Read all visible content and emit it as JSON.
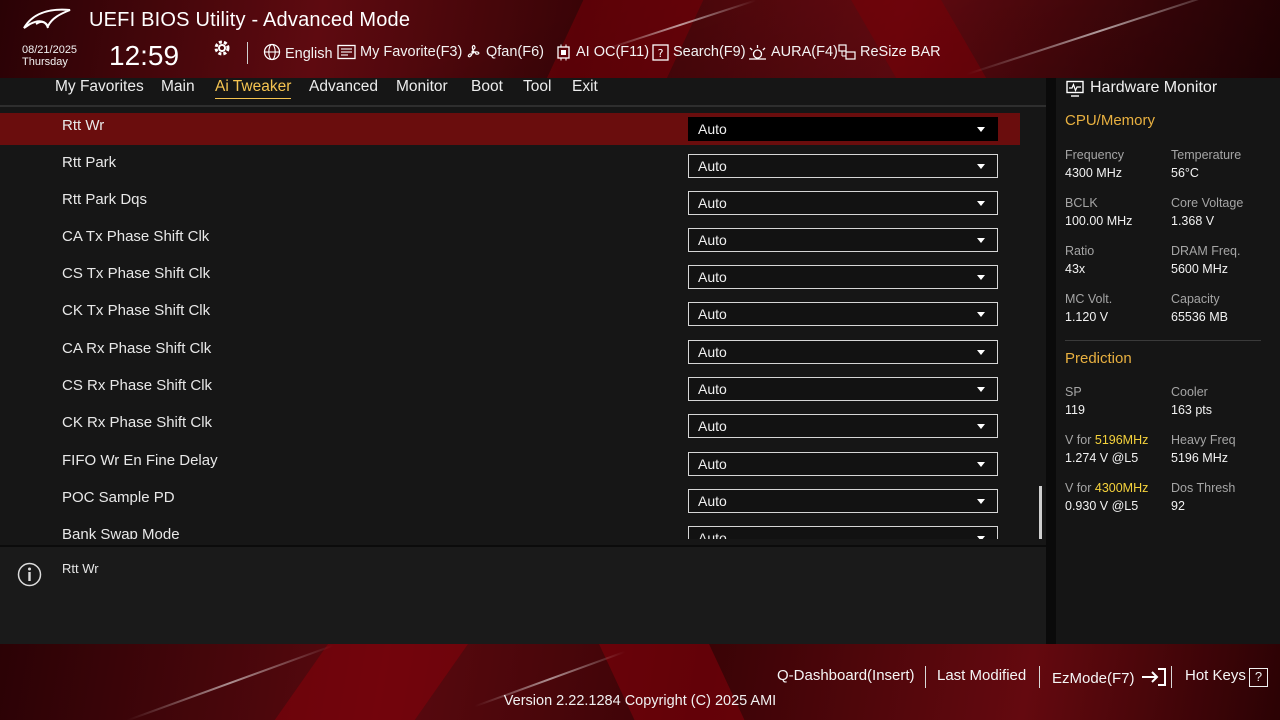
{
  "header": {
    "title": "UEFI BIOS Utility - Advanced Mode",
    "date": "08/21/2025",
    "day": "Thursday",
    "time": "12:59",
    "toolbar": [
      {
        "label": "English",
        "icon": "globe-icon"
      },
      {
        "label": "My Favorite(F3)",
        "icon": "favorite-icon"
      },
      {
        "label": "Qfan(F6)",
        "icon": "fan-icon"
      },
      {
        "label": "AI OC(F11)",
        "icon": "ai-oc-icon"
      },
      {
        "label": "Search(F9)",
        "icon": "search-icon"
      },
      {
        "label": "AURA(F4)",
        "icon": "aura-icon"
      },
      {
        "label": "ReSize BAR",
        "icon": "resize-bar-icon"
      }
    ]
  },
  "tabs": [
    {
      "label": "My Favorites"
    },
    {
      "label": "Main"
    },
    {
      "label": "Ai Tweaker",
      "active": true
    },
    {
      "label": "Advanced"
    },
    {
      "label": "Monitor"
    },
    {
      "label": "Boot"
    },
    {
      "label": "Tool"
    },
    {
      "label": "Exit"
    }
  ],
  "settings": [
    {
      "label": "Rtt Wr",
      "value": "Auto",
      "selected": true
    },
    {
      "label": "Rtt Park",
      "value": "Auto"
    },
    {
      "label": "Rtt Park Dqs",
      "value": "Auto"
    },
    {
      "label": "CA Tx Phase Shift Clk",
      "value": "Auto"
    },
    {
      "label": "CS Tx Phase Shift Clk",
      "value": "Auto"
    },
    {
      "label": "CK Tx Phase Shift Clk",
      "value": "Auto"
    },
    {
      "label": "CA Rx Phase Shift Clk",
      "value": "Auto"
    },
    {
      "label": "CS Rx Phase Shift Clk",
      "value": "Auto"
    },
    {
      "label": "CK Rx Phase Shift Clk",
      "value": "Auto"
    },
    {
      "label": "FIFO Wr En Fine Delay",
      "value": "Auto"
    },
    {
      "label": "POC Sample PD",
      "value": "Auto"
    },
    {
      "label": "Bank Swap Mode",
      "value": "Auto"
    }
  ],
  "info": {
    "text": "Rtt Wr"
  },
  "hardware_monitor": {
    "title": "Hardware Monitor",
    "cpu_memory": {
      "heading": "CPU/Memory",
      "items": [
        {
          "label": "Frequency",
          "value": "4300 MHz"
        },
        {
          "label": "Temperature",
          "value": "56°C"
        },
        {
          "label": "BCLK",
          "value": "100.00 MHz"
        },
        {
          "label": "Core Voltage",
          "value": "1.368 V"
        },
        {
          "label": "Ratio",
          "value": "43x"
        },
        {
          "label": "DRAM Freq.",
          "value": "5600 MHz"
        },
        {
          "label": "MC Volt.",
          "value": "1.120 V"
        },
        {
          "label": "Capacity",
          "value": "65536 MB"
        }
      ]
    },
    "prediction": {
      "heading": "Prediction",
      "sp_label": "SP",
      "sp_value": "119",
      "cooler_label": "Cooler",
      "cooler_value": "163 pts",
      "v1_prefix": "V for ",
      "v1_freq": "5196MHz",
      "v1_value": "1.274 V @L5",
      "heavy_label": "Heavy Freq",
      "heavy_value": "5196 MHz",
      "v2_prefix": "V for ",
      "v2_freq": "4300MHz",
      "v2_value": "0.930 V @L5",
      "dos_label": "Dos Thresh",
      "dos_value": "92"
    }
  },
  "footer": {
    "q_dashboard": "Q-Dashboard(Insert)",
    "last_modified": "Last Modified",
    "ezmode": "EzMode(F7)",
    "hot_keys": "Hot Keys",
    "hot_keys_key": "?",
    "version": "Version 2.22.1284 Copyright (C) 2025 AMI"
  },
  "colors": {
    "accent": "#f5c451",
    "selected_row": "#6a0d0d",
    "brand_red": "#5e0a10"
  }
}
